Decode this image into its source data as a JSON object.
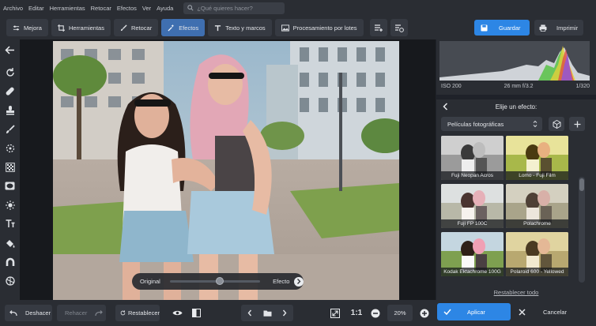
{
  "menu": {
    "items": [
      "Archivo",
      "Editar",
      "Herramientas",
      "Retocar",
      "Efectos",
      "Ver",
      "Ayuda"
    ],
    "search_placeholder": "¿Qué quieres hacer?"
  },
  "toolbar": {
    "tabs": [
      {
        "label": "Mejora",
        "icon": "sliders-icon"
      },
      {
        "label": "Herramientas",
        "icon": "crop-icon"
      },
      {
        "label": "Retocar",
        "icon": "brush-icon"
      },
      {
        "label": "Efectos",
        "icon": "magic-wand-icon",
        "active": true
      },
      {
        "label": "Texto y marcos",
        "icon": "text-icon"
      },
      {
        "label": "Procesamiento por lotes",
        "icon": "images-icon"
      }
    ],
    "save_label": "Guardar",
    "print_label": "Imprimir"
  },
  "left_tools": [
    "back-arrow-icon",
    "rotate-icon",
    "heal-icon",
    "stamp-icon",
    "brush-icon",
    "circle-select-icon",
    "grain-icon",
    "vignette-icon",
    "sun-icon",
    "text-icon",
    "bucket-icon",
    "magnet-icon",
    "palette-icon"
  ],
  "canvas": {
    "compare_left": "Original",
    "compare_right": "Efecto",
    "compare_level": 0.55
  },
  "histogram": {
    "iso": "ISO 200",
    "lens": "26 mm f/3.2",
    "shutter": "1/320"
  },
  "effects": {
    "title": "Elije un efecto:",
    "category": "Películas fotográficas",
    "thumbs": [
      {
        "label": "Fuji Neopan Acros",
        "tone": "bw"
      },
      {
        "label": "Lomo - Fuji Film",
        "tone": "warm"
      },
      {
        "label": "Fuji FP 100C",
        "tone": "pale"
      },
      {
        "label": "Polachrome",
        "tone": "faded"
      },
      {
        "label": "Kodak Ektachrome 100G",
        "tone": "vivid"
      },
      {
        "label": "Polaroid 600 - Yellowed",
        "tone": "yellow"
      }
    ],
    "reset_label": "Restablecer todo"
  },
  "bottom": {
    "undo": "Deshacer",
    "redo": "Rehacer",
    "reset": "Restablecer",
    "ratio": "1:1",
    "zoom": "20%",
    "apply": "Aplicar",
    "cancel": "Cancelar"
  },
  "colors": {
    "accent": "#2d86e5",
    "active_tab": "#3f6fb0",
    "panel": "#2a2d33"
  }
}
